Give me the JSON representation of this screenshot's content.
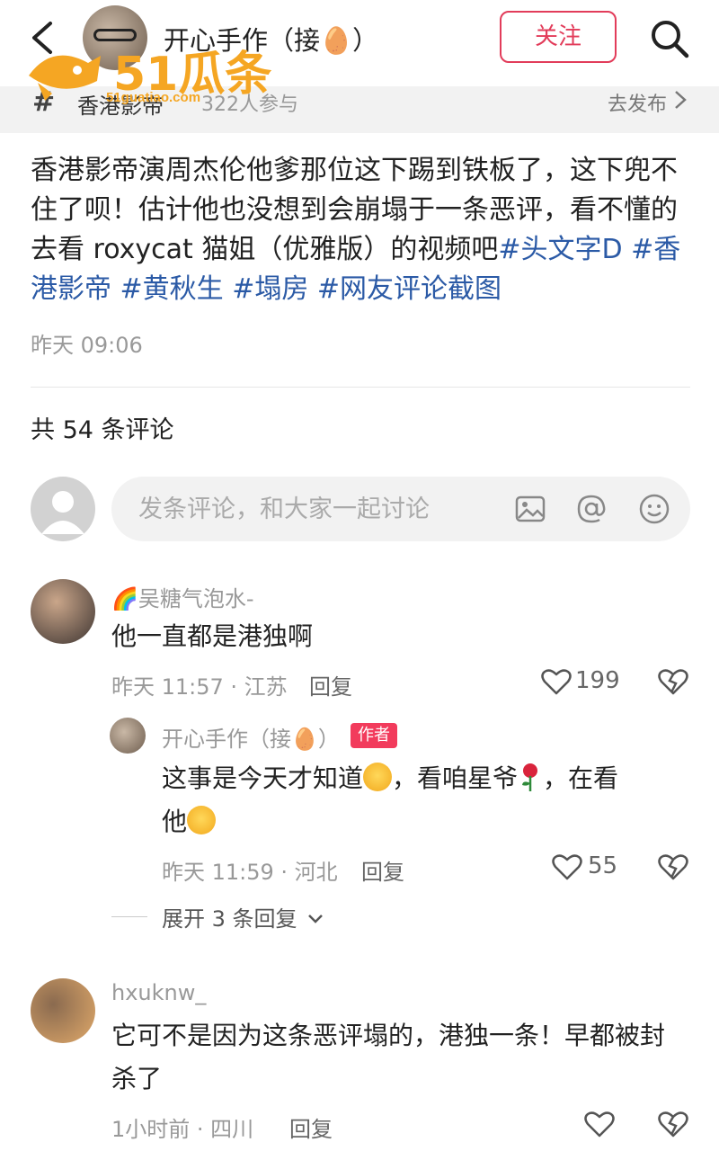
{
  "header": {
    "title": "开心手作（接🥚）",
    "follow_label": "关注"
  },
  "watermark": {
    "logo_text": "51瓜条",
    "url": "51guatiao.com"
  },
  "topic": {
    "name": "香港影帝",
    "count": "322人参与",
    "link": "去发布"
  },
  "post": {
    "text_plain": "香港影帝演周杰伦他爹那位这下踢到铁板了，这下兜不住了呗！估计他也没想到会崩塌于一条恶评，看不懂的去看 roxycat 猫姐（优雅版）的视频吧",
    "hashtags": [
      "#头文字D",
      "#香港影帝",
      "#黄秋生",
      "#塌房",
      "#网友评论截图"
    ],
    "time": "昨天 09:06"
  },
  "comments_header": "共 54 条评论",
  "comment_input": {
    "placeholder": "发条评论，和大家一起讨论"
  },
  "comments": [
    {
      "name": "🌈吴糖气泡水-",
      "text": "他一直都是港独啊",
      "meta": "昨天 11:57 · 江苏",
      "reply_label": "回复",
      "likes": "199",
      "replies": [
        {
          "name": "开心手作（接🥚）",
          "badge": "作者",
          "text_1": "这事是今天才知道",
          "text_2": "，看咱星爷",
          "text_3": "，在看",
          "text_4": "他",
          "meta": "昨天 11:59 · 河北",
          "reply_label": "回复",
          "likes": "55"
        }
      ],
      "expand_label": "展开 3 条回复"
    },
    {
      "name": "hxuknw_",
      "text": "它可不是因为这条恶评塌的，港独一条！早都被封杀了",
      "meta": "1小时前 · 四川",
      "reply_label": "回复",
      "likes": ""
    }
  ],
  "colors": {
    "accent": "#e23c5a",
    "hashtag": "#2b5aa6",
    "badge": "#f23b5c",
    "watermark": "#f5a623"
  }
}
